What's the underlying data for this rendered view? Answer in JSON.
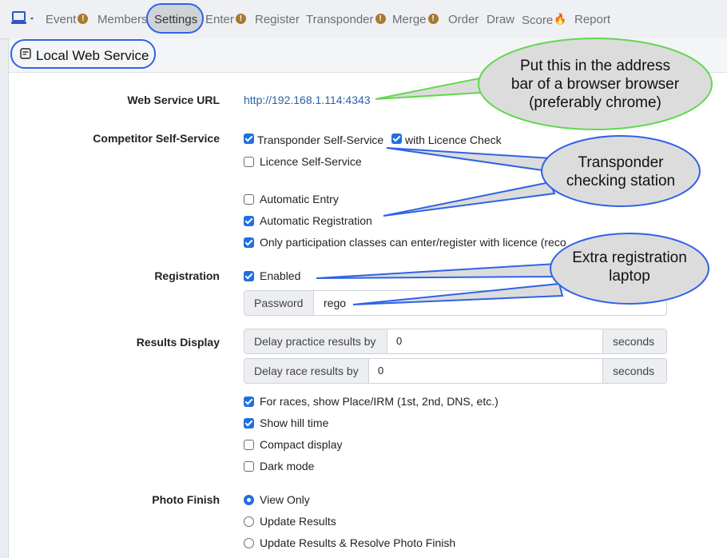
{
  "nav": {
    "items": [
      {
        "label": "Event",
        "badge": "!"
      },
      {
        "label": "Members"
      },
      {
        "label": "Settings",
        "active": true
      },
      {
        "label": "Enter",
        "badge": "!"
      },
      {
        "label": "Register"
      },
      {
        "label": "Transponder",
        "badge": "!"
      },
      {
        "label": "Merge",
        "badge": "!"
      },
      {
        "label": "Order"
      },
      {
        "label": "Draw"
      },
      {
        "label": "Score",
        "flame": true
      },
      {
        "label": "Report"
      }
    ]
  },
  "panel": {
    "title": "Local Web Service",
    "icon": "window-icon"
  },
  "web_service": {
    "label": "Web Service URL",
    "url": "http://192.168.1.114:4343"
  },
  "self_service": {
    "label": "Competitor Self-Service",
    "transponder": "Transponder Self-Service",
    "licence_check": "with Licence Check",
    "licence_self": "Licence Self-Service",
    "auto_entry": "Automatic Entry",
    "auto_reg": "Automatic Registration",
    "participation": "Only participation classes can enter/register with licence (reco"
  },
  "registration": {
    "label": "Registration",
    "enabled": "Enabled",
    "password_label": "Password",
    "password_value": "rego"
  },
  "results": {
    "label": "Results Display",
    "practice_label": "Delay practice results by",
    "practice_value": "0",
    "race_label": "Delay race results by",
    "race_value": "0",
    "seconds": "seconds",
    "place": "For races, show Place/IRM (1st, 2nd, DNS, etc.)",
    "hill": "Show hill time",
    "compact": "Compact display",
    "dark": "Dark mode"
  },
  "photo_finish": {
    "label": "Photo Finish",
    "view_only": "View Only",
    "update": "Update Results",
    "update_resolve": "Update Results & Resolve Photo Finish"
  },
  "callouts": {
    "address_bar": [
      "Put this in the address",
      "bar of a browser browser",
      "(preferably chrome)"
    ],
    "transponder_station": [
      "Transponder",
      "checking station"
    ],
    "extra_laptop": [
      "Extra registration",
      "laptop"
    ]
  },
  "colors": {
    "accent_blue": "#2f63e6",
    "checkbox_blue": "#1f6fe0",
    "green_callout": "#62d84e",
    "callout_fill": "#dcdcdc"
  }
}
